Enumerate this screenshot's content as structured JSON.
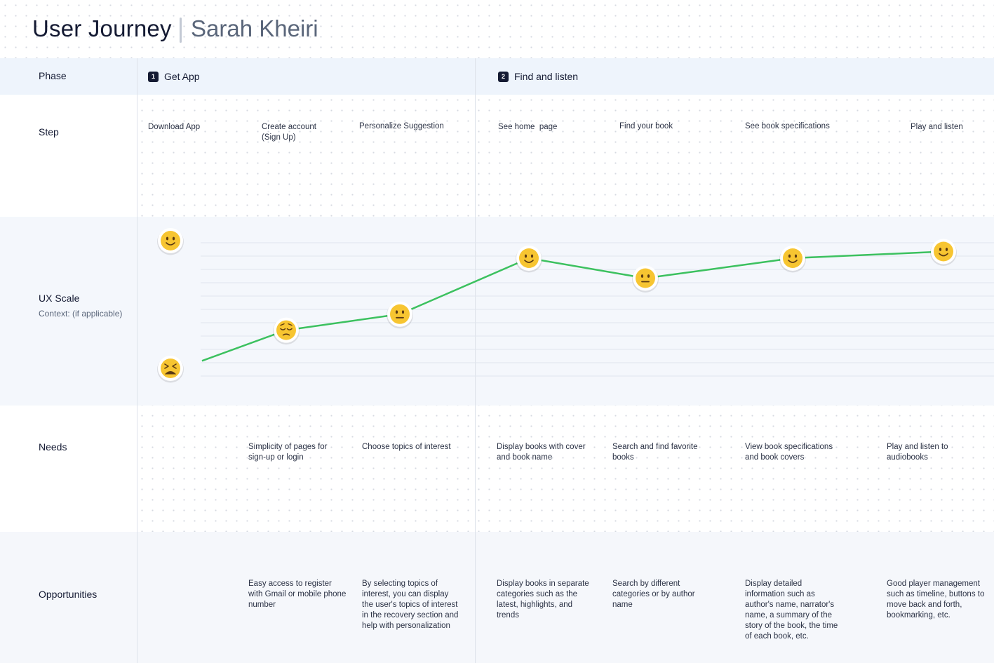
{
  "header": {
    "title": "User Journey",
    "author": "Sarah Kheiri"
  },
  "rows": {
    "phase": "Phase",
    "step": "Step",
    "ux": "UX Scale",
    "ux_context": "Context: (if applicable)",
    "needs": "Needs",
    "opportunities": "Opportunities"
  },
  "phases": [
    {
      "number": "1",
      "label": "Get App"
    },
    {
      "number": "2",
      "label": "Find and listen"
    }
  ],
  "steps": [
    "Download App",
    "Create account\n(Sign Up)",
    "Personalize Suggestion",
    "See home  page",
    "Find your book",
    "See book specifications",
    "Play and listen"
  ],
  "needs": [
    "",
    "Simplicity of pages for\nsign-up or login",
    "Choose topics of interest",
    "Display books with cover\nand book name",
    "Search and find favorite\nbooks",
    "View book specifications\nand book covers",
    "Play and listen to\naudiobooks"
  ],
  "opportunities": [
    "",
    "Easy access to register\nwith Gmail or mobile phone\nnumber",
    "By selecting topics of\ninterest, you can display\nthe user's topics of interest\nin the recovery section and\nhelp with personalization",
    "Display books in separate\ncategories such as the\nlatest, highlights, and\ntrends",
    "Search by different\ncategories or by author\nname",
    "Display detailed\ninformation such as\nauthor's name, narrator's\nname, a summary of the\nstory of the book, the time\nof each book, etc.",
    "Good player management\nsuch as timeline, buttons to\nmove back and forth,\nbookmarking, etc."
  ],
  "chart_data": {
    "type": "line",
    "scale_top_emotion": "happy",
    "scale_bottom_emotion": "frustrated",
    "ylim": [
      0,
      10
    ],
    "points": [
      {
        "step": "Download App",
        "value": 0.3,
        "emotion": null
      },
      {
        "step": "Create account (Sign Up)",
        "value": 2.6,
        "emotion": "sad"
      },
      {
        "step": "Personalize Suggestion",
        "value": 3.8,
        "emotion": "neutral"
      },
      {
        "step": "See home  page",
        "value": 8.0,
        "emotion": "happy"
      },
      {
        "step": "Find your book",
        "value": 6.5,
        "emotion": "neutral"
      },
      {
        "step": "See book specifications",
        "value": 8.0,
        "emotion": "happy"
      },
      {
        "step": "Play and listen",
        "value": 8.5,
        "emotion": "happy"
      }
    ],
    "line_color": "#3cc15f",
    "emoji_color": "#f7c531",
    "grid": true
  }
}
